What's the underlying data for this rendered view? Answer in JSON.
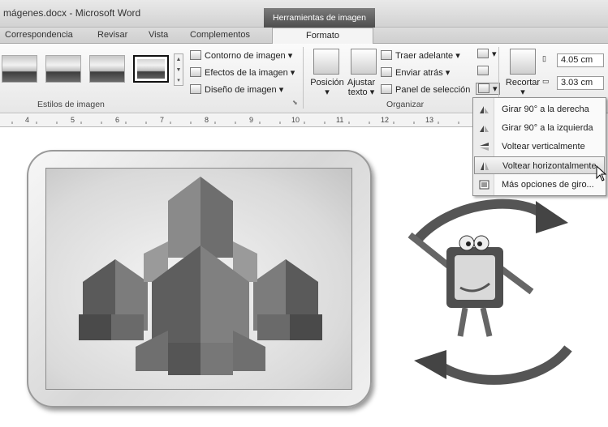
{
  "window": {
    "title": "mágenes.docx - Microsoft Word",
    "context_header": "Herramientas de imagen"
  },
  "tabs": [
    "Correspondencia",
    "Revisar",
    "Vista",
    "Complementos"
  ],
  "active_tab": "Formato",
  "ribbon": {
    "picture_styles": {
      "group_label": "Estilos de imagen",
      "commands": [
        "Contorno de imagen",
        "Efectos de la imagen",
        "Diseño de imagen"
      ]
    },
    "arrange": {
      "group_label": "Organizar",
      "position_label": "Posición",
      "wrap_label_1": "Ajustar",
      "wrap_label_2": "texto",
      "commands": [
        "Traer adelante",
        "Enviar atrás",
        "Panel de selección"
      ]
    },
    "size": {
      "crop_label": "Recortar",
      "height": "4.05 cm",
      "width": "3.03 cm"
    }
  },
  "ruler": {
    "numbers": [
      "4",
      "5",
      "6",
      "7",
      "8",
      "9",
      "10",
      "11",
      "12",
      "13"
    ]
  },
  "rotate_menu": {
    "items": [
      {
        "label": "Girar 90° a la derecha",
        "icon": "rotate-right-icon"
      },
      {
        "label": "Girar 90° a la izquierda",
        "icon": "rotate-left-icon"
      },
      {
        "label": "Voltear verticalmente",
        "icon": "flip-vertical-icon"
      },
      {
        "label": "Voltear horizontalmente",
        "icon": "flip-horizontal-icon",
        "highlighted": true
      },
      {
        "label": "Más opciones de giro...",
        "icon": "more-rotation-icon"
      }
    ]
  }
}
